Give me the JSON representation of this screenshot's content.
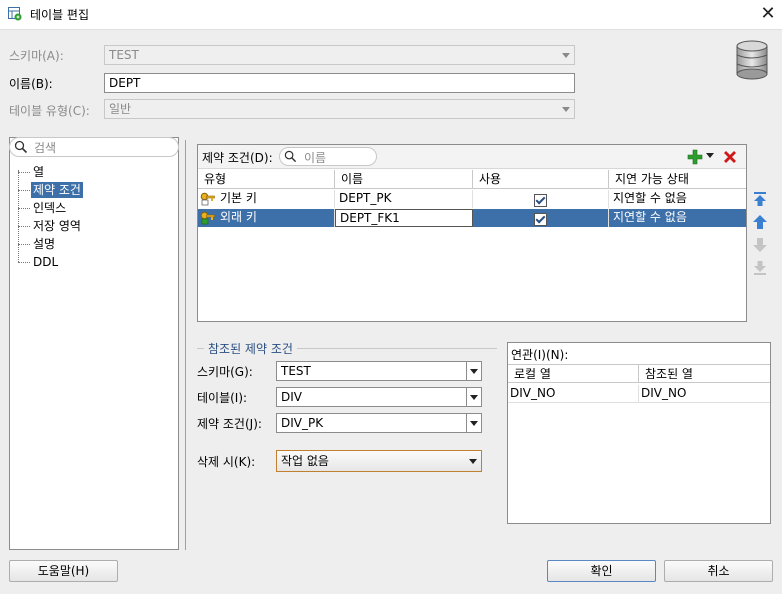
{
  "window": {
    "title": "테이블 편집",
    "close_glyph": "✕"
  },
  "form": {
    "schema_label": "스키마(A):",
    "schema_value": "TEST",
    "name_label": "이름(B):",
    "name_value": "DEPT",
    "table_type_label": "테이블 유형(C):",
    "table_type_value": "일반"
  },
  "nav": {
    "search_placeholder": "검색",
    "items": [
      {
        "label": "열"
      },
      {
        "label": "제약 조건"
      },
      {
        "label": "인덱스"
      },
      {
        "label": "저장 영역"
      },
      {
        "label": "설명"
      },
      {
        "label": "DDL"
      }
    ],
    "selected_index": 1
  },
  "constraints": {
    "label": "제약 조건(D):",
    "filter_placeholder": "이름",
    "columns": [
      "유형",
      "이름",
      "사용",
      "지연 가능 상태"
    ],
    "rows": [
      {
        "type": "기본 키",
        "name": "DEPT_PK",
        "enabled": true,
        "deferrable": "지연할 수 없음"
      },
      {
        "type": "외래 키",
        "name": "DEPT_FK1",
        "enabled": true,
        "deferrable": "지연할 수 없음"
      }
    ],
    "selected_row": 1,
    "colors": {
      "add": "#2e9d2e",
      "delete": "#d01818",
      "move": "#3b7fd0"
    }
  },
  "referenced": {
    "section_title": "참조된 제약 조건",
    "schema_label": "스키마(G):",
    "schema_value": "TEST",
    "table_label": "테이블(I):",
    "table_value": "DIV",
    "constraint_label": "제약 조건(J):",
    "constraint_value": "DIV_PK",
    "on_delete_label": "삭제 시(K):",
    "on_delete_value": "작업 없음"
  },
  "association": {
    "label": "연관(I)(N):",
    "columns": [
      "로컬 열",
      "참조된 열"
    ],
    "rows": [
      {
        "local": "DIV_NO",
        "referenced": "DIV_NO"
      }
    ]
  },
  "buttons": {
    "help": "도움말(H)",
    "ok": "확인",
    "cancel": "취소"
  },
  "accent_color": "#3d6fa8"
}
